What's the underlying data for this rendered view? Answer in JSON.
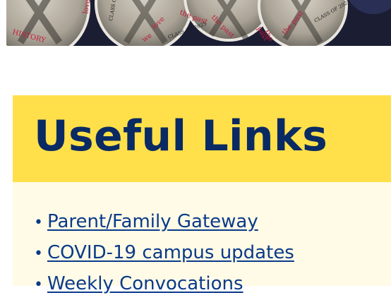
{
  "hero": {
    "image_name": "class-of-2025-history-buttons-photo",
    "button_text": [
      "HISTORY",
      "love",
      "the past",
      "CLASS OF 2025",
      "we",
      "love",
      "the past",
      "CLASS OF 2025",
      "the past",
      "CLASS OF 2025",
      "the",
      "past"
    ]
  },
  "useful_links": {
    "title": "Useful Links",
    "bullet": "•",
    "items": [
      {
        "label": "Parent/Family Gateway"
      },
      {
        "label": "COVID-19 campus updates"
      },
      {
        "label": "Weekly Convocations"
      }
    ]
  },
  "colors": {
    "header_bg": "#ffe04a",
    "body_bg": "#fffbe6",
    "title_text": "#0a2a63",
    "link_text": "#0a3a8a"
  }
}
